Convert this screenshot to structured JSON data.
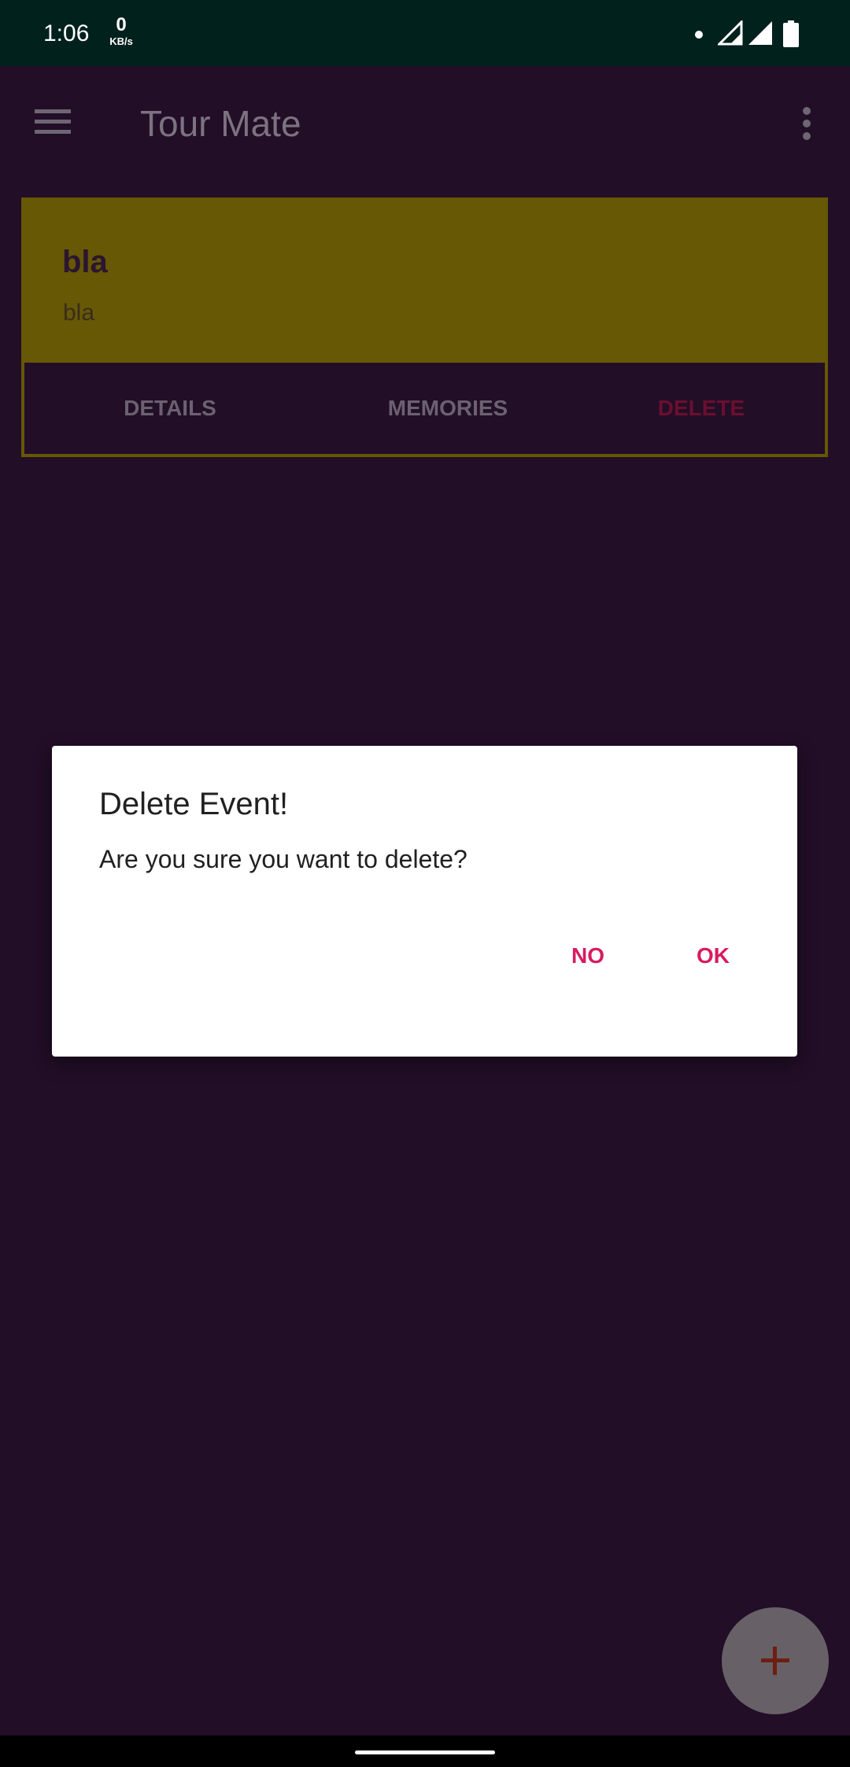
{
  "status_bar": {
    "time": "1:06",
    "net_speed_value": "0",
    "net_speed_unit": "KB/s",
    "icons": [
      "notification-dot-icon",
      "signal-icon",
      "signal-icon",
      "battery-icon"
    ]
  },
  "toolbar": {
    "title": "Tour Mate",
    "menu_icon": "hamburger-menu-icon",
    "overflow_icon": "more-vert-icon"
  },
  "event_card": {
    "title": "bla",
    "subtitle": "bla",
    "actions": {
      "details": "DETAILS",
      "memories": "MEMORIES",
      "delete": "DELETE"
    }
  },
  "dialog": {
    "title": "Delete Event!",
    "message": "Are you sure you want to delete?",
    "negative": "NO",
    "positive": "OK"
  },
  "fab": {
    "icon": "plus-icon"
  },
  "colors": {
    "status_bar": "#01211d",
    "background": "#220e27",
    "card_header": "#665805",
    "accent": "#d81b60",
    "delete_text": "#6b0f2f",
    "fab": "#676167"
  }
}
